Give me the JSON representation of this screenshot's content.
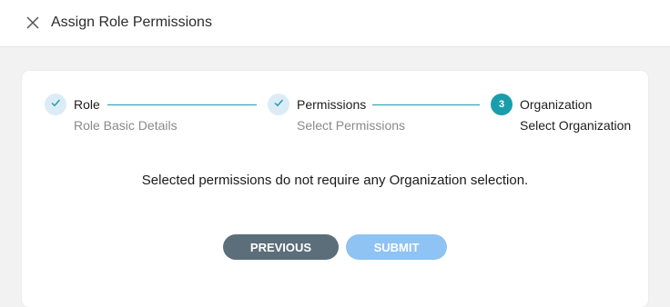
{
  "header": {
    "title": "Assign Role Permissions",
    "close_icon": "close-icon"
  },
  "stepper": {
    "steps": [
      {
        "title": "Role",
        "subtitle": "Role Basic Details",
        "state": "completed",
        "icon": "checkmark-icon"
      },
      {
        "title": "Permissions",
        "subtitle": "Select Permissions",
        "state": "completed",
        "icon": "checkmark-icon"
      },
      {
        "title": "Organization",
        "subtitle": "Select Organization",
        "state": "active",
        "number": "3"
      }
    ]
  },
  "message": "Selected permissions do not require any Organization selection.",
  "buttons": {
    "previous": "PREVIOUS",
    "submit": "SUBMIT"
  },
  "colors": {
    "accent": "#1a9dab",
    "completed_circle": "#dcecf7",
    "previous_button": "#5b6e7a",
    "submit_button": "#8ec3f3"
  }
}
